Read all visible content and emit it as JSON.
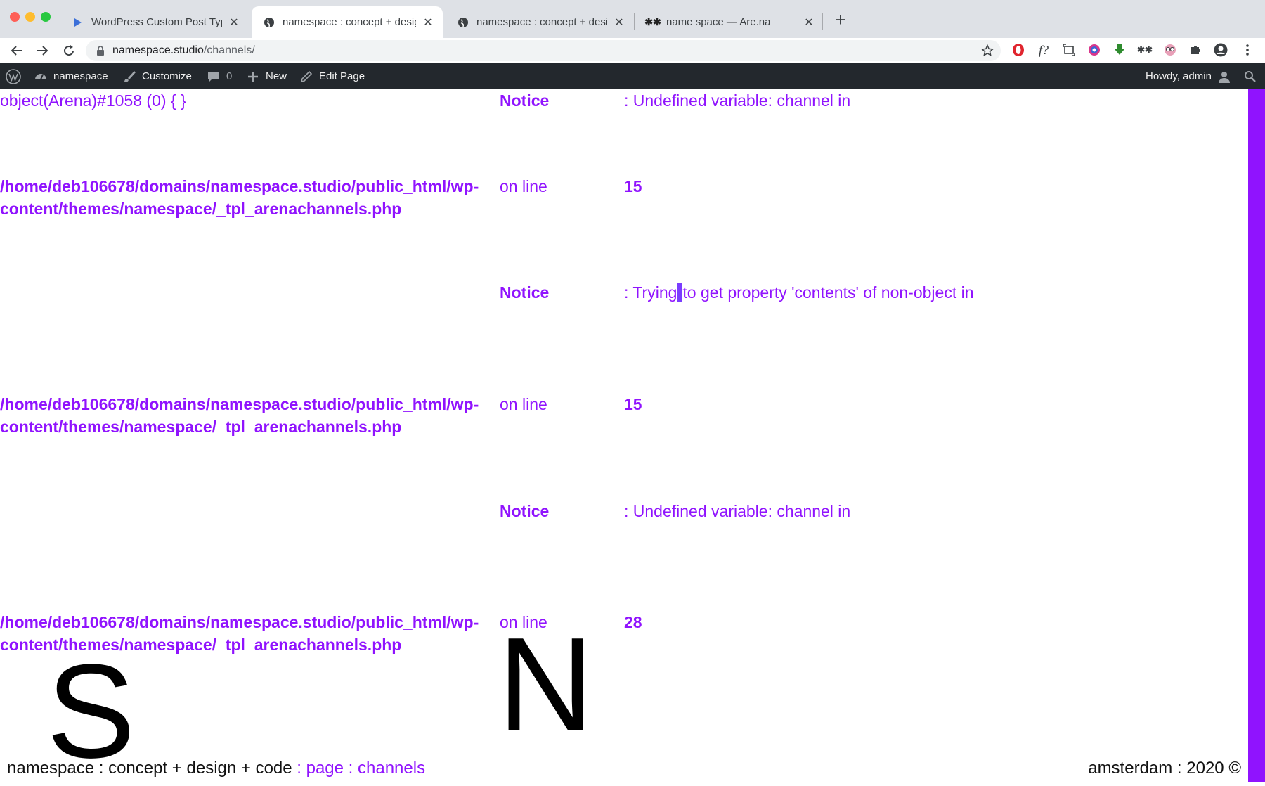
{
  "browser": {
    "tabs": [
      {
        "title": "WordPress Custom Post Type (",
        "active": false,
        "icon": "wp-dev-icon"
      },
      {
        "title": "namespace : concept + design",
        "active": true,
        "icon": "globe-icon"
      },
      {
        "title": "namespace : concept + design",
        "active": false,
        "icon": "globe-icon"
      },
      {
        "title": "name space — Are.na",
        "active": false,
        "icon": "arena-icon"
      }
    ],
    "url_host": "namespace.studio",
    "url_path": "/channels/"
  },
  "adminbar": {
    "site_name": "namespace",
    "customize": "Customize",
    "comments_count": "0",
    "new": "New",
    "edit_page": "Edit Page",
    "howdy": "Howdy, admin"
  },
  "content": {
    "dump": "object(Arena)#1058 (0) { }",
    "notice_label": "Notice",
    "on_line": "on line",
    "path_line1": "/home/deb106678/domains/namespace.studio/public_html/wp-",
    "path_line2": "content/themes/namespace/_tpl_arenachannels.php",
    "notice1_msg": ": Undefined variable: channel in",
    "line1": "15",
    "notice2_msg_a": ": Trying",
    "notice2_msg_b": "to get property 'contents' of non-object in",
    "line2": "15",
    "notice3_msg": ": Undefined variable: channel in",
    "line3": "28",
    "big_s": "S",
    "big_n": "N"
  },
  "footer": {
    "left_main": "namespace : concept + design + code",
    "left_accent": " : page : channels",
    "right": "amsterdam : 2020 ©"
  },
  "colors": {
    "accent": "#9013fe",
    "adminbar_bg": "#23282d",
    "tabbar_bg": "#dee1e6"
  }
}
